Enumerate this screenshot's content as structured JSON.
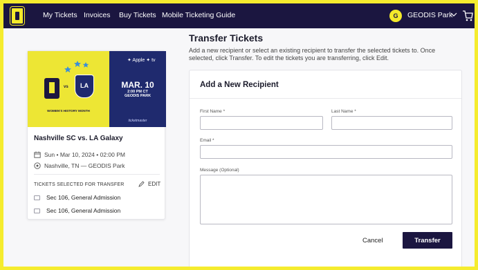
{
  "nav": {
    "links": [
      "My Tickets",
      "Invoices",
      "Buy Tickets",
      "Mobile Ticketing Guide"
    ],
    "user_initial": "G",
    "user_name": "GEODIS Park"
  },
  "event": {
    "banner": {
      "tv_text": "✦ Apple ✦ tv",
      "date": "MAR. 10",
      "time_line1": "2:00 PM CT",
      "time_line2": "GEODIS PARK",
      "history_text": "WOMEN'S HISTORY MONTH",
      "vs": "vs",
      "la": "LA",
      "ticketmaster": "ticketmaster"
    },
    "title": "Nashville SC vs. LA Galaxy",
    "datetime": "Sun • Mar 10, 2024 • 02:00 PM",
    "location": "Nashville, TN — GEODIS Park",
    "selected_label": "TICKETS SELECTED FOR TRANSFER",
    "edit_label": "EDIT",
    "tickets": [
      "Sec 106, General Admission",
      "Sec 106, General Admission"
    ]
  },
  "transfer": {
    "title": "Transfer Tickets",
    "description": "Add a new recipient or select an existing recipient to transfer the selected tickets to. Once selected, click Transfer. To edit the tickets you are transferring, click Edit."
  },
  "form": {
    "title": "Add a New Recipient",
    "first_name_label": "First Name *",
    "last_name_label": "Last Name *",
    "email_label": "Email *",
    "message_label": "Message (Optional)",
    "first_name_value": "",
    "last_name_value": "",
    "email_value": "",
    "message_value": "",
    "cancel_label": "Cancel",
    "transfer_label": "Transfer"
  },
  "colors": {
    "brand_navy": "#1b1640",
    "brand_yellow": "#f4ea2a"
  }
}
